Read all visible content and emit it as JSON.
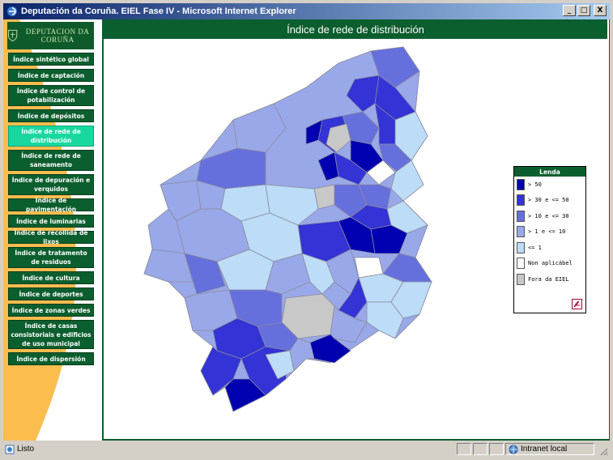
{
  "window": {
    "title": "Deputación da Coruña. EIEL Fase IV - Microsoft Internet Explorer",
    "minimize": "_",
    "maximize": "□",
    "close": "X"
  },
  "logo": {
    "text": "DEPUTACION DA CORUÑA"
  },
  "header": {
    "title": "Índice de rede de distribución"
  },
  "sidebar": {
    "items": [
      {
        "label": "Índice sintético global",
        "active": false
      },
      {
        "label": "Índice de captación",
        "active": false
      },
      {
        "label": "Índice de control de potabilización",
        "active": false
      },
      {
        "label": "Índice de depósitos",
        "active": false
      },
      {
        "label": "Índice de rede de distribución",
        "active": true
      },
      {
        "label": "Índice de rede de saneamento",
        "active": false
      },
      {
        "label": "Índice de depuración e verquidos",
        "active": false
      },
      {
        "label": "Índice de pavimentación",
        "active": false
      },
      {
        "label": "Índice de luminarias",
        "active": false
      },
      {
        "label": "Índice de recollida de lixos",
        "active": false
      },
      {
        "label": "Índice de tratamento de residuos",
        "active": false
      },
      {
        "label": "Índice de cultura",
        "active": false
      },
      {
        "label": "Índice de deportes",
        "active": false
      },
      {
        "label": "Índice de zonas verdes",
        "active": false
      },
      {
        "label": "Índice de casas consistoriais e edificios de uso municipal",
        "active": false
      },
      {
        "label": "Índice de dispersión",
        "active": false
      }
    ]
  },
  "legend": {
    "title": "Lenda",
    "items": [
      {
        "label": "> 50",
        "color": "#0000b0"
      },
      {
        "label": "> 30 e <= 50",
        "color": "#3333d6"
      },
      {
        "label": "> 10 e <= 30",
        "color": "#6670dc"
      },
      {
        "label": "> 1 e <= 10",
        "color": "#99a8e8"
      },
      {
        "label": "<= 1",
        "color": "#bcdcf8"
      },
      {
        "label": "Non aplicábel",
        "color": "#ffffff"
      },
      {
        "label": "Fora da EIEL",
        "color": "#c8c8c8"
      }
    ],
    "pdf_icon": "pdf-icon"
  },
  "status": {
    "text": "Listo",
    "zone": "Intranet local"
  }
}
